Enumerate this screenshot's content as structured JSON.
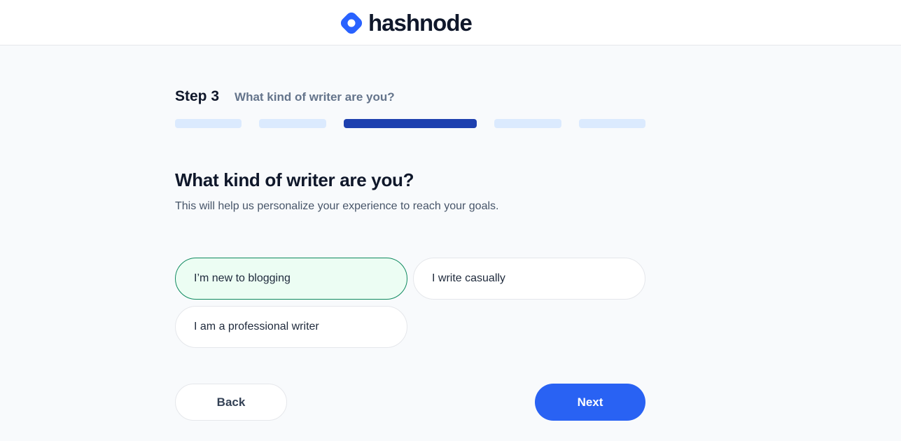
{
  "brand": {
    "name": "hashnode",
    "logo_icon": "hashnode-logo-icon",
    "color": "#2962FF"
  },
  "step": {
    "label": "Step 3",
    "subtitle": "What kind of writer are you?",
    "current": 3,
    "total": 5
  },
  "content": {
    "heading": "What kind of writer are you?",
    "description": "This will help us personalize your experience to reach your goals."
  },
  "options": [
    {
      "label": "I’m new to blogging",
      "selected": true
    },
    {
      "label": "I write casually",
      "selected": false
    },
    {
      "label": "I am a professional writer",
      "selected": false
    }
  ],
  "actions": {
    "back_label": "Back",
    "next_label": "Next"
  },
  "colors": {
    "accent": "#2962F3",
    "progress_active": "#1E40AF",
    "progress_inactive": "#DBEAFE",
    "selected_bg": "#ECFDF3",
    "selected_border": "#0F8A5F"
  }
}
